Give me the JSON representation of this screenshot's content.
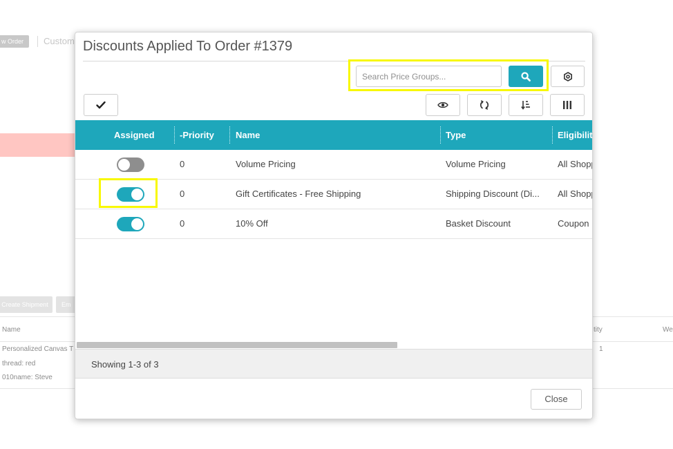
{
  "background": {
    "new_order_label": "w Order",
    "customer_label": "Custom",
    "create_shipment_label": "Create Shipment",
    "email_label": "Em",
    "table_header_name": "Name",
    "table_header_quantity": "tity",
    "table_header_weight": "We",
    "item_name": "Personalized Canvas T",
    "item_opt1": "thread: red",
    "item_opt2": "010name: Steve",
    "item_qty": "1"
  },
  "modal": {
    "title": "Discounts Applied To Order #1379",
    "search": {
      "placeholder": "Search Price Groups..."
    },
    "grid": {
      "columns": [
        "Assigned",
        "-Priority",
        "Name",
        "Type",
        "Eligibilit"
      ],
      "rows": [
        {
          "assigned": false,
          "priority": "0",
          "name": "Volume Pricing",
          "type": "Volume Pricing",
          "eligibility": "All Shopp"
        },
        {
          "assigned": true,
          "priority": "0",
          "name": "Gift Certificates - Free Shipping",
          "type": "Shipping Discount (Di...",
          "eligibility": "All Shopp"
        },
        {
          "assigned": true,
          "priority": "0",
          "name": "10% Off",
          "type": "Basket Discount",
          "eligibility": "Coupon"
        }
      ]
    },
    "footer_text": "Showing 1-3 of 3",
    "close_label": "Close"
  },
  "colors": {
    "accent": "#1ea7bb",
    "highlight": "#f8f800",
    "toggle_off": "#8e8e8e"
  }
}
